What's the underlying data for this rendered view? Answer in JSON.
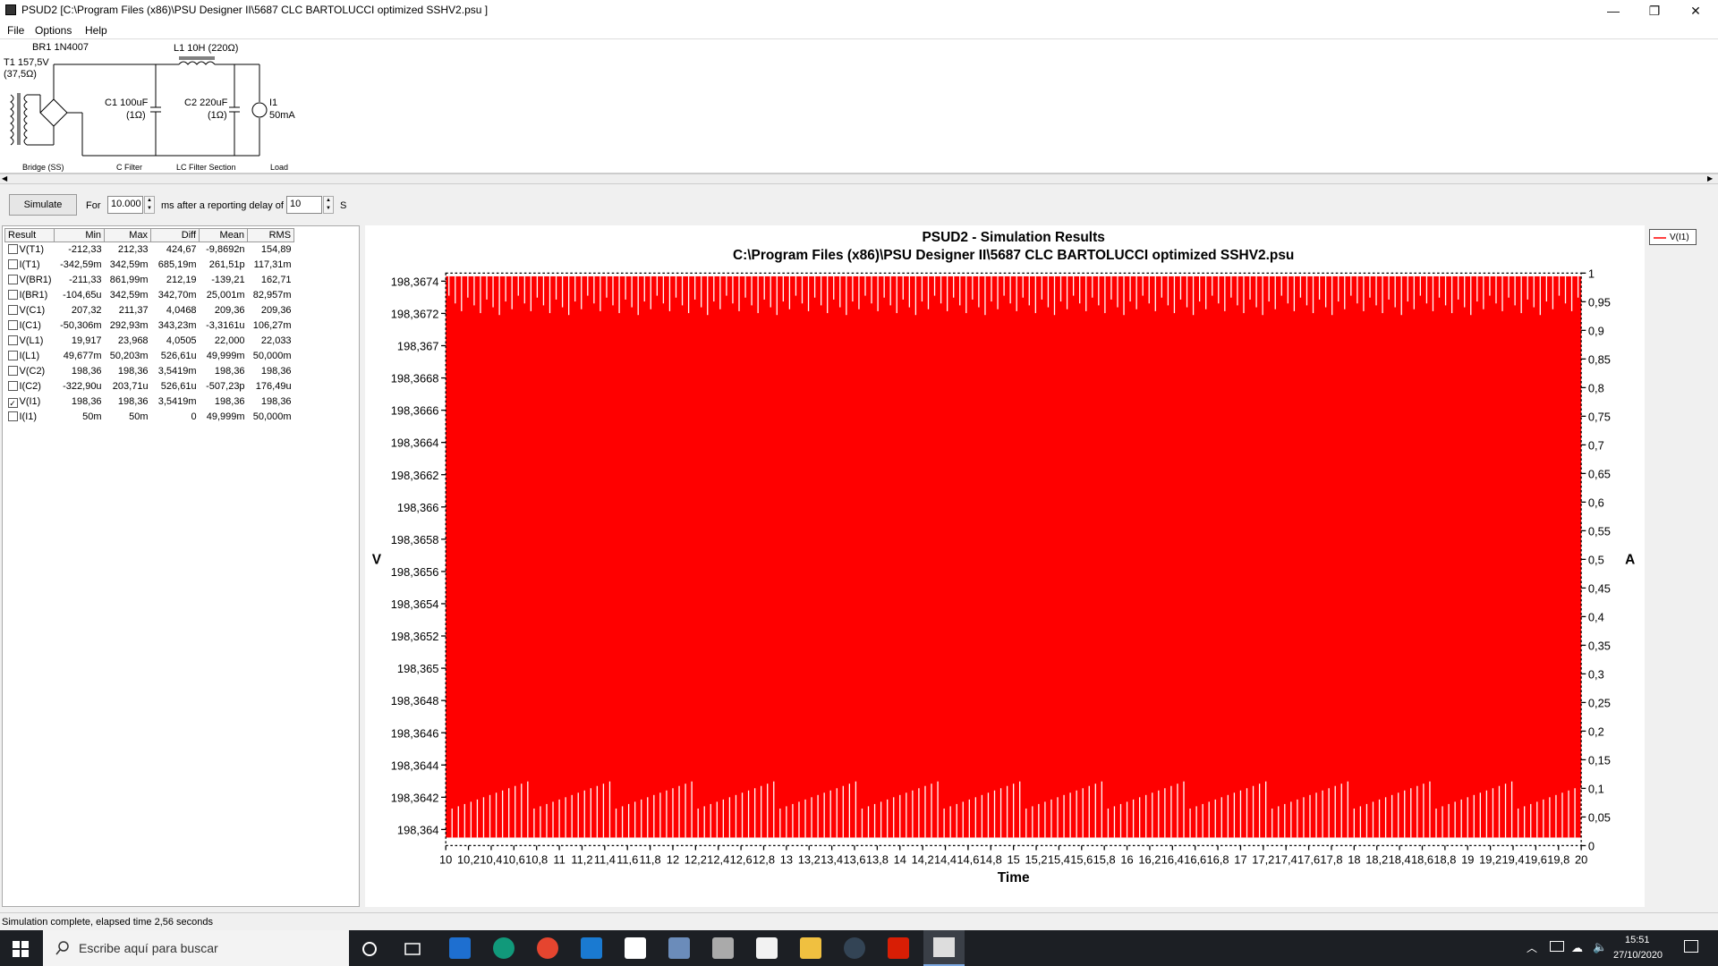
{
  "window": {
    "title": "PSUD2  [C:\\Program Files (x86)\\PSU Designer II\\5687 CLC BARTOLUCCI optimized SSHV2.psu ]",
    "minimize": "—",
    "restore": "❐",
    "close": "✕"
  },
  "menu": [
    "File",
    "Options",
    "Help"
  ],
  "schematic": {
    "br1": "BR1 1N4007",
    "t1_a": "T1 157,5V",
    "t1_b": "(37,5Ω)",
    "l1": "L1 10H (220Ω)",
    "c1_a": "C1 100uF",
    "c1_b": "(1Ω)",
    "c2_a": "C2 220uF",
    "c2_b": "(1Ω)",
    "i1_a": "I1",
    "i1_b": "50mA",
    "sec_bridge": "Bridge (SS)",
    "sec_cfilter": "C Filter",
    "sec_lc": "LC Filter Section",
    "sec_load": "Load"
  },
  "controls": {
    "simulate": "Simulate",
    "for": "For",
    "duration": "10.000",
    "ms_label": "ms  after a reporting delay of",
    "delay": "10",
    "s_label": "S"
  },
  "table": {
    "headers": [
      "Result",
      "Min",
      "Max",
      "Diff",
      "Mean",
      "RMS"
    ],
    "rows": [
      {
        "name": "V(T1)",
        "checked": false,
        "min": "-212,33",
        "max": "212,33",
        "diff": "424,67",
        "mean": "-9,8692n",
        "rms": "154,89"
      },
      {
        "name": "I(T1)",
        "checked": false,
        "min": "-342,59m",
        "max": "342,59m",
        "diff": "685,19m",
        "mean": "261,51p",
        "rms": "117,31m"
      },
      {
        "name": "V(BR1)",
        "checked": false,
        "min": "-211,33",
        "max": "861,99m",
        "diff": "212,19",
        "mean": "-139,21",
        "rms": "162,71"
      },
      {
        "name": "I(BR1)",
        "checked": false,
        "min": "-104,65u",
        "max": "342,59m",
        "diff": "342,70m",
        "mean": "25,001m",
        "rms": "82,957m"
      },
      {
        "name": "V(C1)",
        "checked": false,
        "min": "207,32",
        "max": "211,37",
        "diff": "4,0468",
        "mean": "209,36",
        "rms": "209,36"
      },
      {
        "name": "I(C1)",
        "checked": false,
        "min": "-50,306m",
        "max": "292,93m",
        "diff": "343,23m",
        "mean": "-3,3161u",
        "rms": "106,27m"
      },
      {
        "name": "V(L1)",
        "checked": false,
        "min": "19,917",
        "max": "23,968",
        "diff": "4,0505",
        "mean": "22,000",
        "rms": "22,033"
      },
      {
        "name": "I(L1)",
        "checked": false,
        "min": "49,677m",
        "max": "50,203m",
        "diff": "526,61u",
        "mean": "49,999m",
        "rms": "50,000m"
      },
      {
        "name": "V(C2)",
        "checked": false,
        "min": "198,36",
        "max": "198,36",
        "diff": "3,5419m",
        "mean": "198,36",
        "rms": "198,36"
      },
      {
        "name": "I(C2)",
        "checked": false,
        "min": "-322,90u",
        "max": "203,71u",
        "diff": "526,61u",
        "mean": "-507,23p",
        "rms": "176,49u"
      },
      {
        "name": "V(I1)",
        "checked": true,
        "min": "198,36",
        "max": "198,36",
        "diff": "3,5419m",
        "mean": "198,36",
        "rms": "198,36"
      },
      {
        "name": "I(I1)",
        "checked": false,
        "min": "50m",
        "max": "50m",
        "diff": "0",
        "mean": "49,999m",
        "rms": "50,000m"
      }
    ]
  },
  "chart_data": {
    "type": "line",
    "title": "PSUD2 - Simulation Results",
    "subtitle": "C:\\Program Files (x86)\\PSU Designer II\\5687 CLC BARTOLUCCI optimized SSHV2.psu",
    "xlabel": "Time",
    "ylabel": "V",
    "y2label": "A",
    "xlim": [
      10,
      20
    ],
    "ylim": [
      198.3639,
      198.36745
    ],
    "y2lim": [
      0,
      1
    ],
    "x_ticks": [
      "10",
      "10,2",
      "10,4",
      "10,6",
      "10,8",
      "11",
      "11,2",
      "11,4",
      "11,6",
      "11,8",
      "12",
      "12,2",
      "12,4",
      "12,6",
      "12,8",
      "13",
      "13,2",
      "13,4",
      "13,6",
      "13,8",
      "14",
      "14,2",
      "14,4",
      "14,6",
      "14,8",
      "15",
      "15,2",
      "15,4",
      "15,6",
      "15,8",
      "16",
      "16,2",
      "16,4",
      "16,6",
      "16,8",
      "17",
      "17,2",
      "17,4",
      "17,6",
      "17,8",
      "18",
      "18,2",
      "18,4",
      "18,6",
      "18,8",
      "19",
      "19,2",
      "19,4",
      "19,6",
      "19,8",
      "20"
    ],
    "y_ticks": [
      "198,3674",
      "198,3672",
      "198,367",
      "198,3668",
      "198,3666",
      "198,3664",
      "198,3662",
      "198,366",
      "198,3658",
      "198,3656",
      "198,3654",
      "198,3652",
      "198,365",
      "198,3648",
      "198,3646",
      "198,3644",
      "198,3642",
      "198,364"
    ],
    "y_tick_values": [
      198.3674,
      198.3672,
      198.367,
      198.3668,
      198.3666,
      198.3664,
      198.3662,
      198.366,
      198.3658,
      198.3656,
      198.3654,
      198.3652,
      198.365,
      198.3648,
      198.3646,
      198.3644,
      198.3642,
      198.364
    ],
    "y2_ticks": [
      "1",
      "0,95",
      "0,9",
      "0,85",
      "0,8",
      "0,75",
      "0,7",
      "0,65",
      "0,6",
      "0,55",
      "0,5",
      "0,45",
      "0,4",
      "0,35",
      "0,3",
      "0,25",
      "0,2",
      "0,15",
      "0,1",
      "0,05",
      "0"
    ],
    "series": [
      {
        "name": "V(I1)",
        "color": "#ff0000",
        "min": 198.36395,
        "max": 198.36743
      }
    ],
    "legend": "top-right"
  },
  "status": "Simulation complete, elapsed time 2,56 seconds",
  "taskbar": {
    "search_placeholder": "Escribe aquí para buscar",
    "time": "15:51",
    "date": "27/10/2020"
  }
}
